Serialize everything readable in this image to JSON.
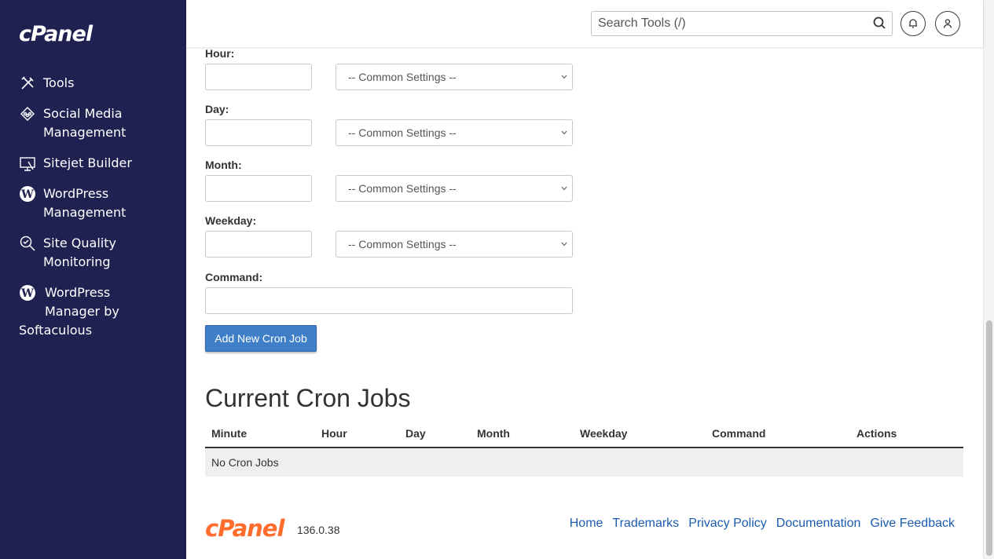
{
  "sidebar": {
    "logo": "cPanel",
    "items": [
      {
        "label": "Tools",
        "icon": "tools-icon"
      },
      {
        "label": "Social Media Management",
        "icon": "social-media-icon"
      },
      {
        "label": "Sitejet Builder",
        "icon": "sitejet-icon"
      },
      {
        "label": "WordPress Management",
        "icon": "wordpress-icon"
      },
      {
        "label": "Site Quality Monitoring",
        "icon": "search-quality-icon"
      },
      {
        "label_line1": "WordPress",
        "label_line2": "Manager by",
        "label_line3": "Softaculous",
        "icon": "wordpress-icon"
      }
    ]
  },
  "topbar": {
    "search_placeholder": "Search Tools (/)"
  },
  "form": {
    "hour_label": "Hour:",
    "day_label": "Day:",
    "month_label": "Month:",
    "weekday_label": "Weekday:",
    "command_label": "Command:",
    "common_settings": "-- Common Settings --",
    "add_button": "Add New Cron Job"
  },
  "cron_jobs": {
    "title": "Current Cron Jobs",
    "columns": [
      "Minute",
      "Hour",
      "Day",
      "Month",
      "Weekday",
      "Command",
      "Actions"
    ],
    "empty_text": "No Cron Jobs"
  },
  "footer": {
    "logo": "cPanel",
    "version": "136.0.38",
    "links": [
      "Home",
      "Trademarks",
      "Privacy Policy",
      "Documentation",
      "Give Feedback"
    ]
  },
  "colors": {
    "sidebar_bg": "#1f2151",
    "button_bg": "#3f7fc7",
    "link": "#1b5cb0",
    "brand_orange": "#ff6c2c"
  }
}
